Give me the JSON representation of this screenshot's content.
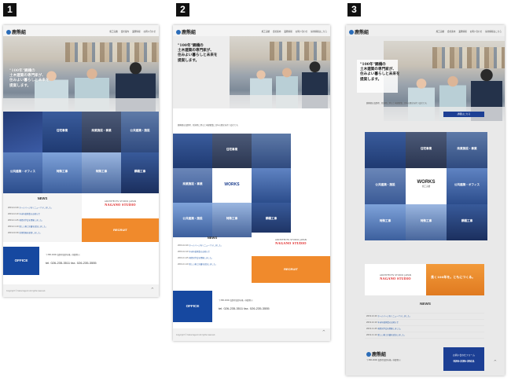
{
  "labels": {
    "one": "1",
    "two": "2",
    "three": "3"
  },
  "logo": {
    "text": "鹿熊組"
  },
  "nav": [
    "施工実績",
    "会社案内",
    "業務情報",
    "お問い合わせ",
    "採用情報はこちら",
    "社員紹介"
  ],
  "hero": {
    "line1": "\"100年\"鋼橋の",
    "line2": "土木建築の専門家が、",
    "line3": "住みよい暮らしと未来を",
    "line4": "提案します。"
  },
  "intro": "鹿熊組は長野県、新潟県に跨る土木建築業に百年の歴史を持つ会社です。",
  "tiles": {
    "house": "住宅事業",
    "commercial": "商業施設・事業",
    "public": "公共建築・オフィス",
    "ex_public": "公共建築・施設",
    "heat": "特殊工事",
    "bridge": "鋼橋工事",
    "works": "WORKS",
    "works_sub": "施工実績"
  },
  "news": {
    "heading": "NEWS",
    "items": [
      {
        "date": "2019.12.20",
        "text": "ホームページをリニューアルしました。"
      },
      {
        "date": "2019.12.10",
        "text": "年末年始休業のお知らせ"
      },
      {
        "date": "2019.11.25",
        "text": "現場見学会を開催しました。"
      },
      {
        "date": "2019.11.10",
        "text": "新しい施工実績を追加しました。"
      },
      {
        "date": "2019.10.30",
        "text": "採用情報を更新しました。"
      }
    ]
  },
  "studio": {
    "line1": "ARCHITECTS STUDIO JAPAN",
    "line2": "NAGANO STUDIO"
  },
  "recruit": {
    "label": "RECRUIT"
  },
  "office": {
    "label": "OFFICE",
    "address": "〒388-0006 長野県長野市篠ノ井御幣川",
    "tel": "tel. 026-235-3511",
    "fax": "fax. 026-235-3555"
  },
  "footer": {
    "copyright": "Copyright © Kakumagumi All rights reserved."
  },
  "banner": {
    "text": "長く100年を。ともにつくる。"
  },
  "more_button": {
    "label": "詳細はこちら"
  },
  "contact": {
    "title": "お問い合わせフォーム",
    "tel": "026-235-3511"
  },
  "totop": {
    "icon": "^"
  }
}
